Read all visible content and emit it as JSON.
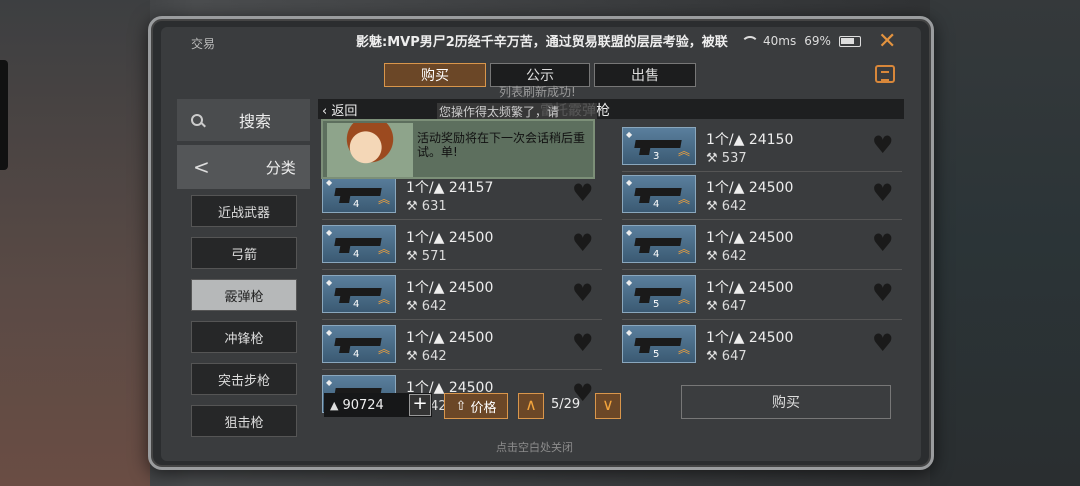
{
  "statusbar": {
    "app_name": "交易",
    "ticker": "影魅:MVP男尸2历经千辛万苦，通过贸易联盟的层层考验，被联",
    "signal": "40ms",
    "battery": "69%"
  },
  "tabs": [
    "购买",
    "公示",
    "出售"
  ],
  "sidebar": {
    "search_label": "搜索",
    "category_label": "分类",
    "categories": [
      "近战武器",
      "弓箭",
      "霰弹枪",
      "冲锋枪",
      "突击步枪",
      "狙击枪"
    ],
    "selected": "霰弹枪"
  },
  "list": {
    "back_label": "返回",
    "title": "雷托霰弹枪"
  },
  "toasts": {
    "refresh": "列表刷新成功!",
    "too_frequent": "您操作得太频繁了，请",
    "banner": "活动奖励将在下一次会话稍后重试。单!"
  },
  "items": [
    {
      "price": "1个/▲ 24157",
      "stock": "631",
      "tier": "4"
    },
    {
      "price": "1个/▲ 24150",
      "stock": "537",
      "tier": "3"
    },
    {
      "price": "1个/▲ 24500",
      "stock": "571",
      "tier": "4"
    },
    {
      "price": "1个/▲ 24500",
      "stock": "642",
      "tier": "4"
    },
    {
      "price": "1个/▲ 24500",
      "stock": "642",
      "tier": "4"
    },
    {
      "price": "1个/▲ 24500",
      "stock": "642",
      "tier": "4"
    },
    {
      "price": "1个/▲ 24500",
      "stock": "642",
      "tier": "4"
    },
    {
      "price": "1个/▲ 24500",
      "stock": "647",
      "tier": "5"
    },
    {
      "price": "1个/▲ 24500",
      "stock": "642",
      "tier": "4"
    },
    {
      "price": "1个/▲ 24500",
      "stock": "647",
      "tier": "5"
    }
  ],
  "bottom": {
    "wallet": "90724",
    "sort_label": "价格",
    "page": "5/29",
    "buy_label": "购买",
    "hint": "点击空白处关闭"
  }
}
